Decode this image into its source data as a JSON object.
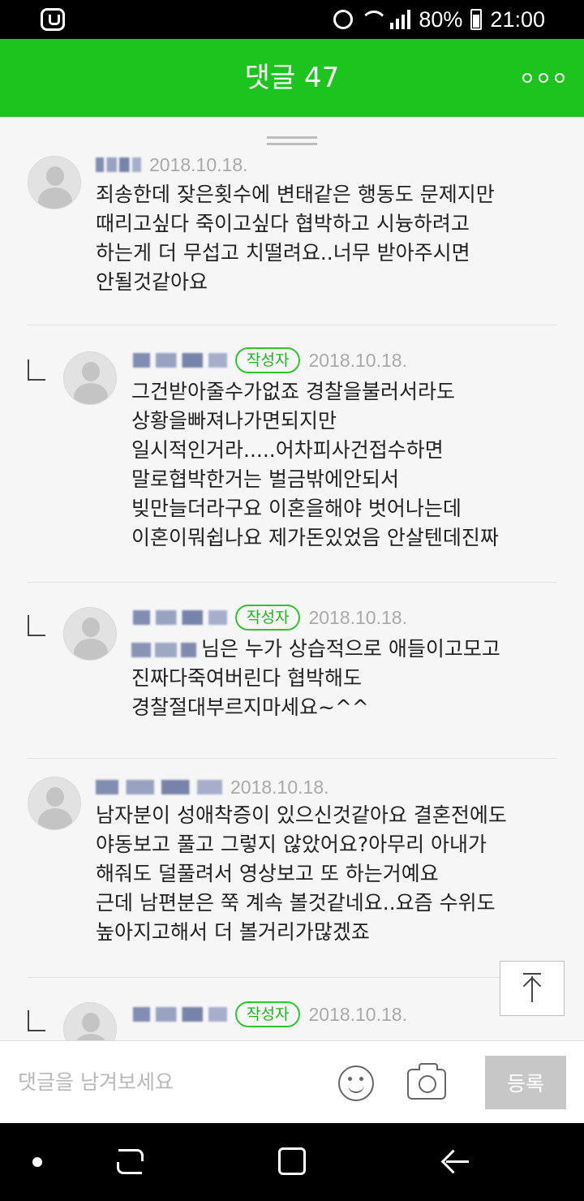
{
  "status_bar": {
    "battery": "80%",
    "time": "21:00"
  },
  "header": {
    "title": "댓글 47"
  },
  "comments": [
    {
      "date": "2018.10.18.",
      "text": "죄송한데 잦은횟수에 변태같은 행동도 문제지만\n때리고싶다 죽이고싶다 협박하고 시늉하려고\n하는게 더 무섭고 치떨려요..너무 받아주시면\n안될것같아요"
    },
    {
      "badge": "작성자",
      "date": "2018.10.18.",
      "text": "그건받아줄수가없죠 경찰을불러서라도\n상황을빠져나가면되지만\n일시적인거라.....어차피사건접수하면\n말로협박한거는 벌금밖에안되서\n빚만늘더라구요 이혼을해야 벗어나는데\n이혼이뭐쉽나요 제가돈있었음 안살텐데진짜"
    },
    {
      "badge": "작성자",
      "date": "2018.10.18.",
      "text": "님은 누가 상습적으로 애들이고모고\n진짜다죽여버린다 협박해도\n경찰절대부르지마세요~^^"
    },
    {
      "date": "2018.10.18.",
      "text": "남자분이 성애착증이 있으신것같아요 결혼전에도\n야동보고 풀고 그렇지 않았어요?아무리 아내가\n해줘도 덜풀려서 영상보고 또 하는거예요\n근데 남편분은 쭉 계속 볼것같네요..요즘 수위도\n높아지고해서 더 볼거리가많겠죠"
    },
    {
      "badge": "작성자",
      "date": "2018.10.18.",
      "text": ""
    }
  ],
  "input": {
    "placeholder": "댓글을 남겨보세요",
    "submit_label": "등록"
  },
  "icons": {
    "more": "more-dots-icon",
    "scroll_top": "scroll-to-top-icon",
    "emoji": "emoji-icon",
    "camera": "camera-icon",
    "avatar": "default-avatar-icon",
    "reply": "reply-indent-icon"
  },
  "colors": {
    "accent": "#1ec41e",
    "badge": "#2cc72c",
    "date": "#a9a9a9",
    "submit_disabled": "#c7c7c7"
  }
}
